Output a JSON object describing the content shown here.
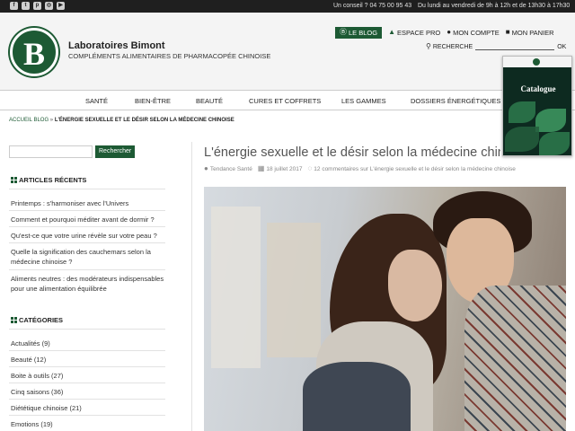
{
  "topbar": {
    "social_icons": [
      "facebook-icon",
      "twitter-icon",
      "pinterest-icon",
      "instagram-icon",
      "youtube-icon"
    ],
    "phone": "Un conseil ? 04 75 00 95 43",
    "hours": "Du lundi au vendredi de 9h à 12h et de 13h30 à 17h30"
  },
  "header": {
    "logo_letter": "B",
    "brand_name": "Laboratoires Bimont",
    "brand_tagline": "COMPLÉMENTS ALIMENTAIRES DE PHARMACOPÉE CHINOISE",
    "links": {
      "blog": "LE BLOG",
      "pro": "ESPACE PRO",
      "account": "MON COMPTE",
      "cart": "MON PANIER"
    },
    "search_label": "RECHERCHE",
    "search_ok": "OK"
  },
  "nav": {
    "items": [
      "SANTÉ",
      "BIEN-ÊTRE",
      "BEAUTÉ",
      "CURES ET COFFRETS",
      "LES GAMMES",
      "DOSSIERS ÉNERGÉTIQUES"
    ]
  },
  "catalogue": {
    "title": "Catalogue"
  },
  "breadcrumb": {
    "home": "ACCUEIL BLOG",
    "separator": "»",
    "current": "L'ÉNERGIE SEXUELLE ET LE DÉSIR SELON LA MÉDECINE CHINOISE"
  },
  "sidebar": {
    "search_button": "Rechercher",
    "recent_title": "ARTICLES RÉCENTS",
    "recent": [
      "Printemps : s'harmoniser avec l'Univers",
      "Comment et pourquoi méditer avant de dormir ?",
      "Qu'est-ce que votre urine révèle sur votre peau ?",
      "Quelle la signification des cauchemars selon la médecine chinoise ?",
      "Aliments neutres : des modérateurs indispensables pour une alimentation équilibrée"
    ],
    "categories_title": "CATÉGORIES",
    "categories": [
      "Actualités (9)",
      "Beauté (12)",
      "Boite à outils (27)",
      "Cinq saisons (36)",
      "Diététique chinoise (21)",
      "Emotions (19)"
    ]
  },
  "article": {
    "title": "L'énergie sexuelle et le désir selon la médecine chinoise",
    "author": "Tendance Santé",
    "date": "18 juillet 2017",
    "comments": "12 commentaires sur L'énergie sexuelle et le désir selon la médecine chinoise"
  },
  "colors": {
    "brand_green": "#1d5a34",
    "topbar": "#1f1f1f",
    "header_bg": "#f4f4f4"
  }
}
